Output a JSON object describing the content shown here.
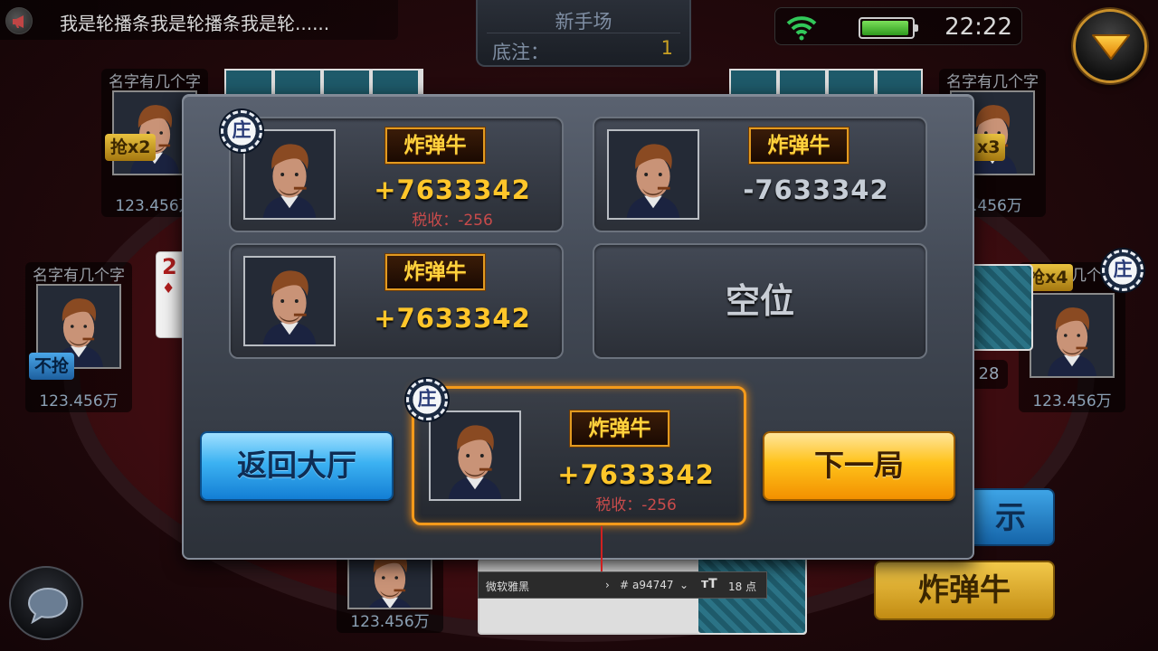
{
  "marquee": {
    "text": "我是轮播条我是轮播条我是轮......",
    "icon": "megaphone-icon"
  },
  "room": {
    "title": "新手场",
    "bet_label": "底注：",
    "bet_value": "1"
  },
  "status": {
    "time": "22:22",
    "battery_level": 0.95,
    "wifi": "wifi-icon"
  },
  "seats": {
    "top_left": {
      "name": "名字有几个字",
      "tag": "抢x2",
      "money": "123.456万"
    },
    "top_right": {
      "name": "名字有几个字",
      "tag": "x3",
      "money": "3.456万"
    },
    "left": {
      "name": "名字有几个字",
      "tag": "不抢",
      "money": "123.456万"
    },
    "right": {
      "name": "几个",
      "tag": "抢x4",
      "money": "123.456万",
      "extra": "28"
    },
    "bottom": {
      "money": "123.456万"
    }
  },
  "table_card": {
    "rank": "2",
    "suit": "♦"
  },
  "bg_buttons": {
    "hint": "示",
    "bomb": "炸弹牛"
  },
  "font_toolbar": {
    "font": "微软雅黑",
    "color": "a94747",
    "size": "18 点"
  },
  "dealer_label": "庄",
  "results": [
    {
      "hand": "炸弹牛",
      "score": "+7633342",
      "tax": "税收：-256",
      "dealer": true
    },
    {
      "hand": "炸弹牛",
      "score": "-7633342",
      "tax": "",
      "dealer": false
    },
    {
      "hand": "炸弹牛",
      "score": "+7633342",
      "tax": "",
      "dealer": false
    },
    {
      "empty": "空位"
    }
  ],
  "me": {
    "hand": "炸弹牛",
    "score": "+7633342",
    "tax": "税收：-256",
    "dealer": true
  },
  "buttons": {
    "back": "返回大厅",
    "next": "下一局"
  },
  "colors": {
    "win": "#ffc62a",
    "lose": "#c6cdd6",
    "tax": "#c94b4b",
    "highlight": "#f59a1a"
  }
}
